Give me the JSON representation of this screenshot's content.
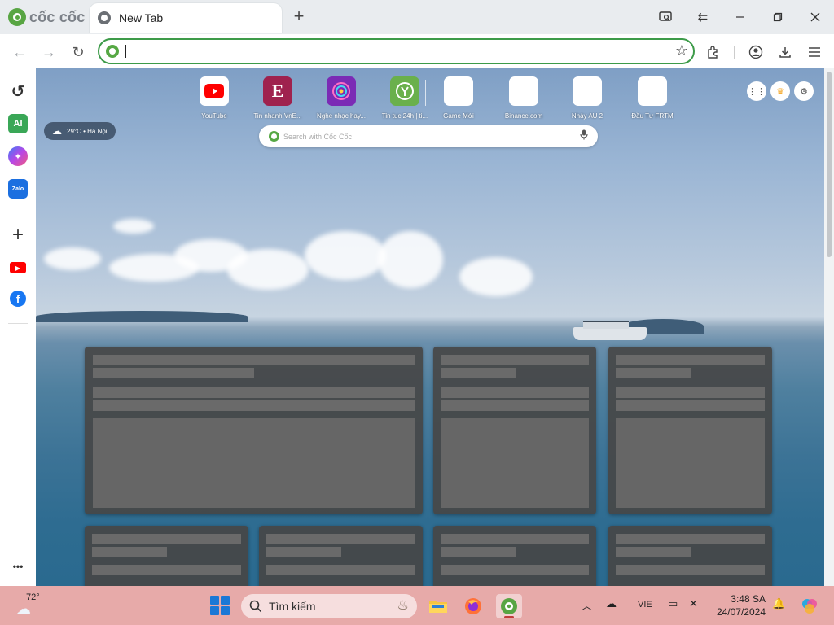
{
  "browser": {
    "brand": "cốc cốc",
    "tab_title": "New Tab",
    "new_tab": "+",
    "omnibox_value": ""
  },
  "sidebar": {
    "items": [
      {
        "name": "history-icon",
        "label": "↺"
      },
      {
        "name": "ai-icon",
        "label": "AI"
      },
      {
        "name": "messenger-icon",
        "label": "✦"
      },
      {
        "name": "zalo-icon",
        "label": "Zalo"
      },
      {
        "name": "add-icon",
        "label": "+"
      },
      {
        "name": "youtube-icon",
        "label": "▶"
      },
      {
        "name": "facebook-icon",
        "label": "f"
      },
      {
        "name": "more-icon",
        "label": "•••"
      }
    ]
  },
  "newtab": {
    "weather": "29°C • Hà Nội",
    "search_placeholder": "Search with Cốc Cốc",
    "shortcuts": [
      {
        "label": "YouTube",
        "icon": "youtube-icon"
      },
      {
        "label": "Tin nhanh VnE...",
        "icon": "vnexpress-icon"
      },
      {
        "label": "Nghe nhạc hay...",
        "icon": "music-icon"
      },
      {
        "label": "Tin tuc 24h | ti...",
        "icon": "news-icon"
      },
      {
        "label": "Game Mới",
        "icon": "blank-icon"
      },
      {
        "label": "Binance.com",
        "icon": "blank-icon"
      },
      {
        "label": "Nhảy AU 2",
        "icon": "blank-icon"
      },
      {
        "label": "Đầu Tư FRTM",
        "icon": "blank-icon"
      }
    ]
  },
  "taskbar": {
    "weather_temp": "72°",
    "search_label": "Tìm kiếm",
    "language": "VIE",
    "time": "3:48 SA",
    "date": "24/07/2024"
  },
  "colors": {
    "accent": "#3d9b49",
    "taskbar": "#e7aaa9",
    "youtube": "#ff0000"
  }
}
